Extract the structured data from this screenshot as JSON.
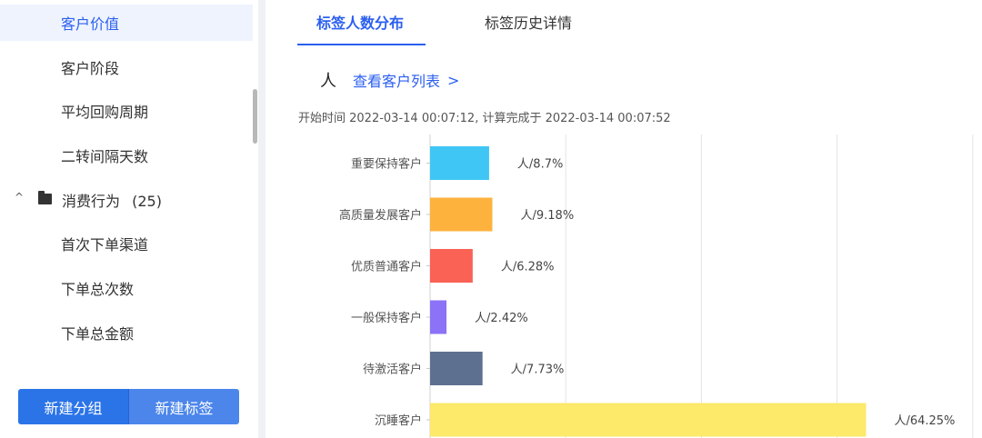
{
  "sidebar": {
    "items": [
      {
        "label": "客户价值",
        "active": true
      },
      {
        "label": "客户阶段",
        "active": false
      },
      {
        "label": "平均回购周期",
        "active": false
      },
      {
        "label": "二转间隔天数",
        "active": false
      }
    ],
    "group": {
      "chevron_icon": "chevron-up-icon",
      "folder_icon": "folder-icon",
      "label": "消费行为",
      "count": "(25)"
    },
    "group_items": [
      {
        "label": "首次下单渠道"
      },
      {
        "label": "下单总次数"
      },
      {
        "label": "下单总金额"
      }
    ],
    "buttons": {
      "new_group": "新建分组",
      "new_tag": "新建标签"
    }
  },
  "tabs": [
    {
      "label": "标签人数分布",
      "active": true
    },
    {
      "label": "标签历史详情",
      "active": false
    }
  ],
  "summary": {
    "count": "",
    "unit": "人",
    "view_link": "查看客户列表",
    "view_link_icon": "chevron-right-icon"
  },
  "time_info": "开始时间 2022-03-14 00:07:12, 计算完成于 2022-03-14 00:07:52",
  "chart_data": {
    "type": "bar",
    "orientation": "horizontal",
    "categories": [
      "重要保持客户",
      "高质量发展客户",
      "优质普通客户",
      "一般保持客户",
      "待激活客户",
      "沉睡客户"
    ],
    "values": [
      8.7,
      9.18,
      6.28,
      2.42,
      7.73,
      64.25
    ],
    "labels": [
      "人/8.7%",
      "人/9.18%",
      "人/6.28%",
      "人/2.42%",
      "人/7.73%",
      "人/64.25%"
    ],
    "colors": [
      "#3fc6f5",
      "#fdb23e",
      "#fa6256",
      "#8c72f6",
      "#5e7090",
      "#fde96a"
    ],
    "grid": true,
    "xlim": [
      0,
      80
    ]
  }
}
